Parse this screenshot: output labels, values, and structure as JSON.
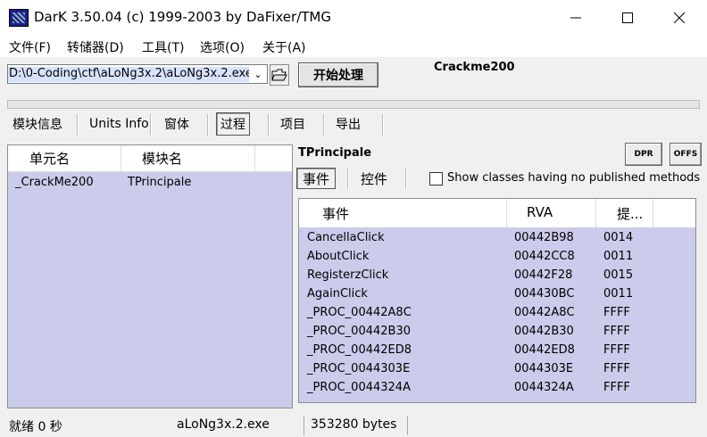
{
  "window": {
    "title": "DarK 3.50.04 (c) 1999-2003 by DaFixer/TMG"
  },
  "menu": [
    "文件(F)",
    "转储器(D)",
    "工具(T)",
    "选项(O)",
    "关于(A)"
  ],
  "toolbar": {
    "path_value": "D:\\0-Coding\\ctf\\aLoNg3x.2\\aLoNg3x.2.exe",
    "start_label": "开始处理",
    "target_name": "Crackme200"
  },
  "tabs": [
    "模块信息",
    "Units Info",
    "窗体",
    "过程",
    "项目",
    "导出"
  ],
  "selected_tab": "过程",
  "left_table": {
    "headers": [
      "单元名",
      "模块名"
    ],
    "rows": [
      {
        "unit": "_CrackMe200",
        "module": "TPrincipale"
      }
    ]
  },
  "class_name": "TPrincipale",
  "buttons": {
    "dpr": "DPR",
    "offs": "OFFS"
  },
  "subtabs": [
    "事件",
    "控件"
  ],
  "selected_subtab": "事件",
  "show_classes_label": "Show classes having no published methods",
  "events_table": {
    "headers": [
      "事件",
      "RVA",
      "提..."
    ],
    "rows": [
      {
        "name": "CancellaClick",
        "rva": "00442B98",
        "hint": "0014"
      },
      {
        "name": "AboutClick",
        "rva": "00442CC8",
        "hint": "0011"
      },
      {
        "name": "RegisterzClick",
        "rva": "00442F28",
        "hint": "0015"
      },
      {
        "name": "AgainClick",
        "rva": "004430BC",
        "hint": "0011"
      },
      {
        "name": "_PROC_00442A8C",
        "rva": "00442A8C",
        "hint": "FFFF"
      },
      {
        "name": "_PROC_00442B30",
        "rva": "00442B30",
        "hint": "FFFF"
      },
      {
        "name": "_PROC_00442ED8",
        "rva": "00442ED8",
        "hint": "FFFF"
      },
      {
        "name": "_PROC_0044303E",
        "rva": "0044303E",
        "hint": "FFFF"
      },
      {
        "name": "_PROC_0044324A",
        "rva": "0044324A",
        "hint": "FFFF"
      }
    ]
  },
  "status": {
    "state": "就绪 0 秒",
    "file": "aLoNg3x.2.exe",
    "size": "353280 bytes"
  },
  "colors": {
    "list_bg": "#cbcbeb",
    "selection": "#d7e3fa"
  }
}
